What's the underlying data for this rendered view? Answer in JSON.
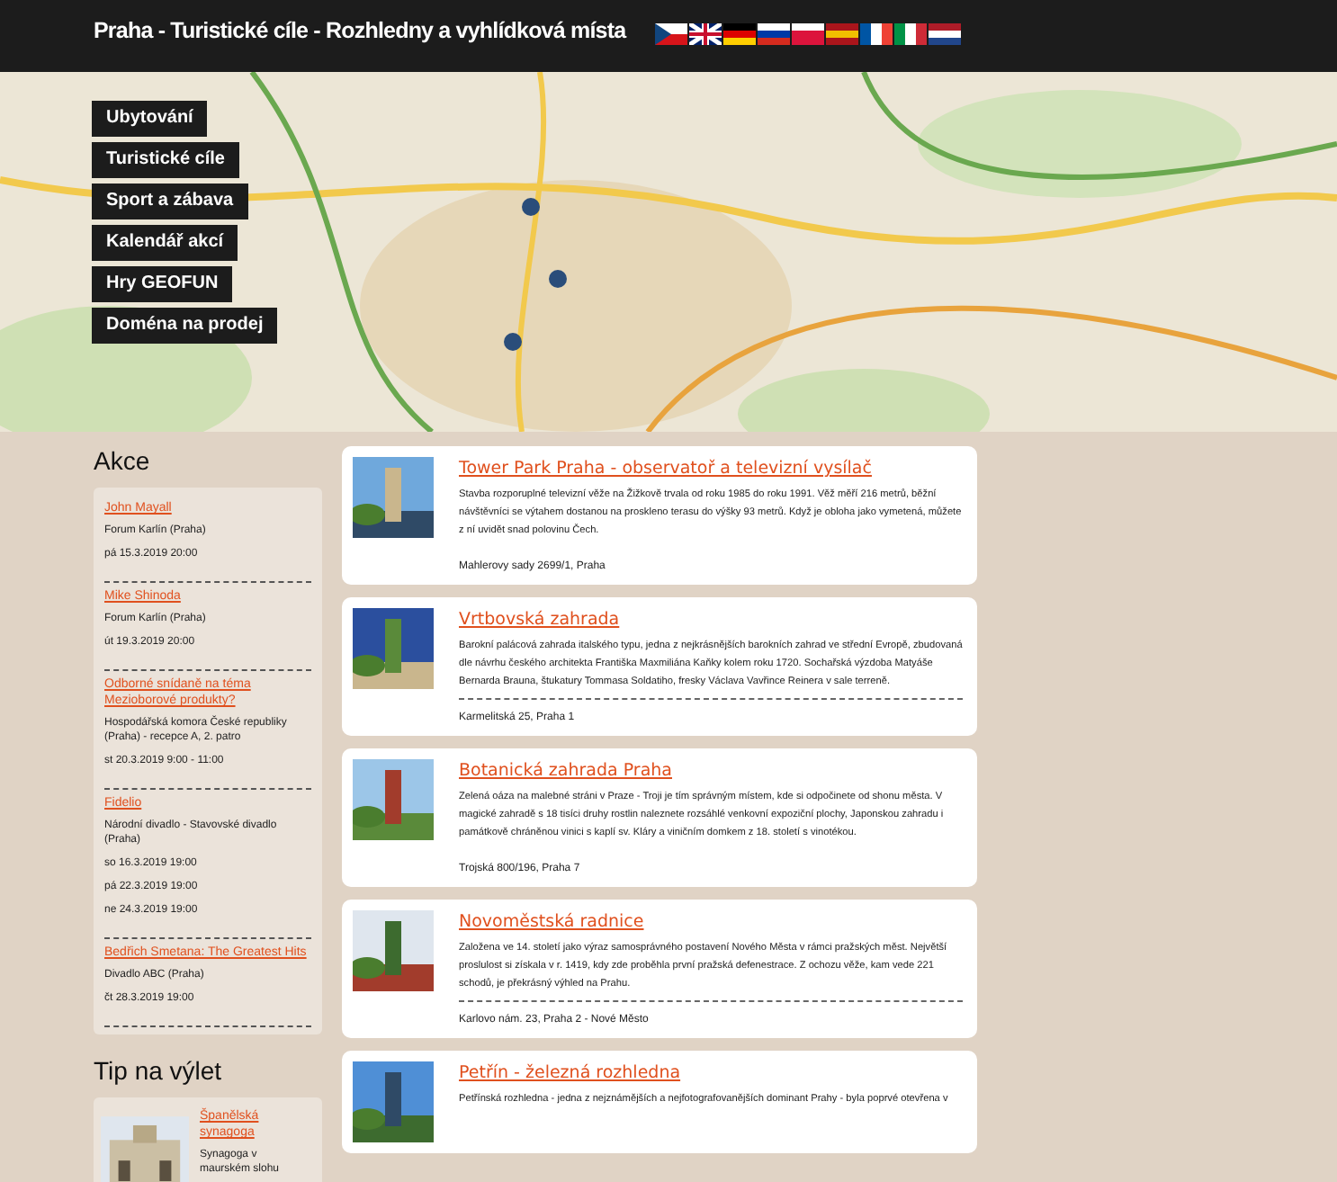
{
  "header": {
    "title": "Praha - Turistické cíle - Rozhledny a vyhlídková místa"
  },
  "menu": [
    "Ubytování",
    "Turistické cíle",
    "Sport a zábava",
    "Kalendář akcí",
    "Hry GEOFUN",
    "Doména na prodej"
  ],
  "events": {
    "heading": "Akce",
    "items": [
      {
        "title": "John Mayall",
        "venue": "Forum Karlín (Praha)",
        "dates": [
          "pá 15.3.2019 20:00"
        ]
      },
      {
        "title": "Mike Shinoda",
        "venue": "Forum Karlín (Praha)",
        "dates": [
          "út 19.3.2019 20:00"
        ]
      },
      {
        "title": "Odborné snídaně na téma Mezioborové produkty?",
        "venue": "Hospodářská komora České republiky (Praha) - recepce A, 2. patro",
        "dates": [
          "st 20.3.2019 9:00 - 11:00"
        ]
      },
      {
        "title": "Fidelio",
        "venue": "Národní divadlo - Stavovské divadlo (Praha)",
        "dates": [
          "so 16.3.2019 19:00",
          "pá 22.3.2019 19:00",
          "ne 24.3.2019 19:00"
        ]
      },
      {
        "title": "Bedřich Smetana: The Greatest Hits",
        "venue": "Divadlo ABC (Praha)",
        "dates": [
          "čt 28.3.2019 19:00"
        ]
      }
    ]
  },
  "tip": {
    "heading": "Tip na výlet",
    "title": "Španělská synagoga",
    "text": "Synagoga v maurském slohu"
  },
  "places": [
    {
      "title": "Tower Park Praha - observatoř a televizní vysílač",
      "text": "Stavba rozporuplné televizní věže na Žižkově trvala od roku 1985 do roku 1991. Věž měří 216 metrů, běžní návštěvníci se výtahem dostanou na proskleno terasu do výšky 93 metrů. Když je obloha jako vymetená, můžete z ní uvidět snad polovinu Čech.",
      "address": "Mahlerovy sady 2699/1, Praha",
      "divider": false
    },
    {
      "title": "Vrtbovská zahrada",
      "text": "Barokní palácová zahrada italského typu, jedna z nejkrásnějších barokních zahrad ve střední Evropě, zbudovaná dle návrhu českého architekta Františka Maxmiliána Kaňky kolem roku 1720. Sochařská výzdoba Matyáše Bernarda Brauna, štukatury Tommasa Soldatiho, fresky Václava Vavřince Reinera v sale terreně.",
      "address": "Karmelitská 25, Praha 1",
      "divider": true
    },
    {
      "title": "Botanická zahrada Praha",
      "text": "Zelená oáza na malebné stráni v Praze - Troji je tím správným místem, kde si odpočinete od shonu města. V magické zahradě s 18 tisíci druhy rostlin naleznete rozsáhlé venkovní expoziční plochy, Japonskou zahradu i památkově chráněnou vinici s kaplí sv. Kláry a viničním domkem z 18. století s vinotékou.",
      "address": "Trojská 800/196, Praha 7",
      "divider": false
    },
    {
      "title": "Novoměstská radnice",
      "text": "Založena ve 14. století jako výraz samosprávného postavení Nového Města v rámci pražských měst. Největší proslulost si získala v r. 1419, kdy zde proběhla první pražská defenestrace. Z ochozu věže, kam vede 221 schodů, je překrásný výhled na Prahu.",
      "address": "Karlovo nám. 23, Praha 2 - Nové Město",
      "divider": true
    },
    {
      "title": "Petřín - železná rozhledna",
      "text": "Petřínská rozhledna - jedna z nejznámějších a nejfotografovanějších dominant Prahy - byla poprvé otevřena v"
    }
  ]
}
